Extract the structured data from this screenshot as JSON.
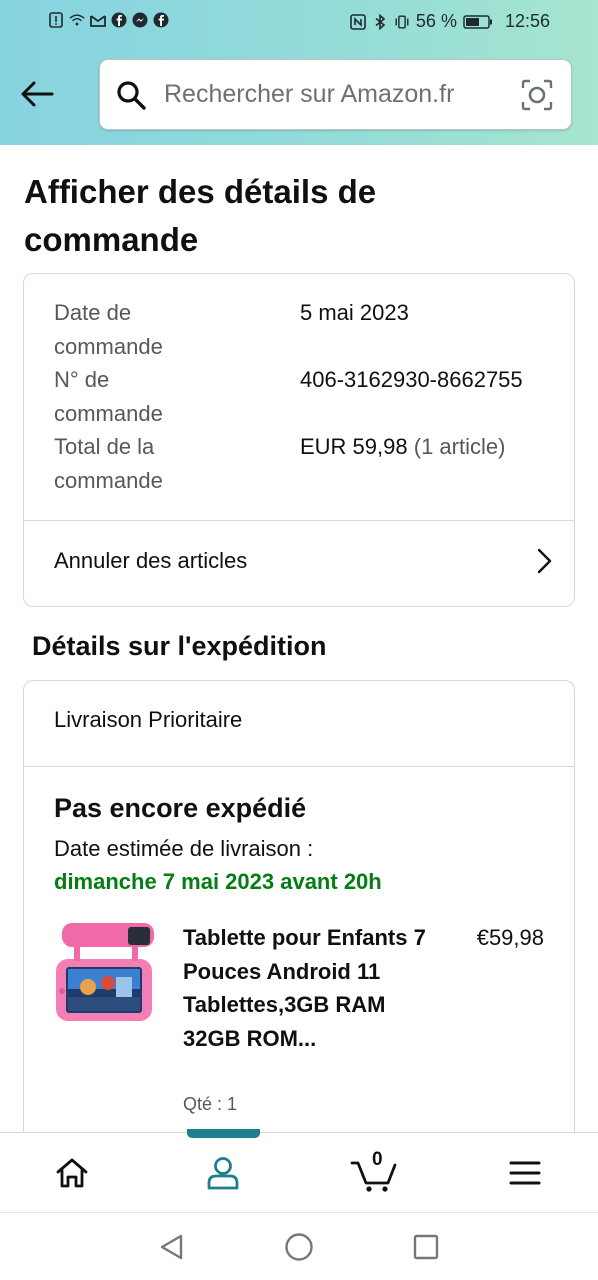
{
  "status_bar": {
    "battery_percent": "56 %",
    "time": "12:56"
  },
  "header": {
    "back_icon": "arrow-left-icon",
    "search_placeholder": "Rechercher sur Amazon.fr",
    "camera_icon": "camera-scan-icon"
  },
  "page": {
    "title": "Afficher des détails de commande"
  },
  "order_info": {
    "date_label": "Date de commande",
    "date_value": "5 mai 2023",
    "number_label": "N° de commande",
    "number_value": "406-3162930-8662755",
    "total_label": "Total de la commande",
    "total_value": "EUR 59,98",
    "total_items": "(1 article)",
    "cancel_label": "Annuler des articles"
  },
  "shipping": {
    "section_title": "Détails sur l'expédition",
    "method": "Livraison Prioritaire",
    "status": "Pas encore expédié",
    "estimate_label": "Date estimée de livraison :",
    "estimate_date": "dimanche 7 mai 2023 avant 20h",
    "estimate_color": "#067d12"
  },
  "product": {
    "title": "Tablette pour Enfants 7 Pouces Android 11 Tablettes,3GB RAM 32GB ROM...",
    "price": "€59,98",
    "quantity": "Qté : 1"
  },
  "bottom_nav": {
    "items": [
      {
        "icon": "home-icon"
      },
      {
        "icon": "account-icon",
        "active": true
      },
      {
        "icon": "cart-icon",
        "count": "0"
      },
      {
        "icon": "menu-icon"
      }
    ],
    "accent": "#1b7f8e"
  }
}
